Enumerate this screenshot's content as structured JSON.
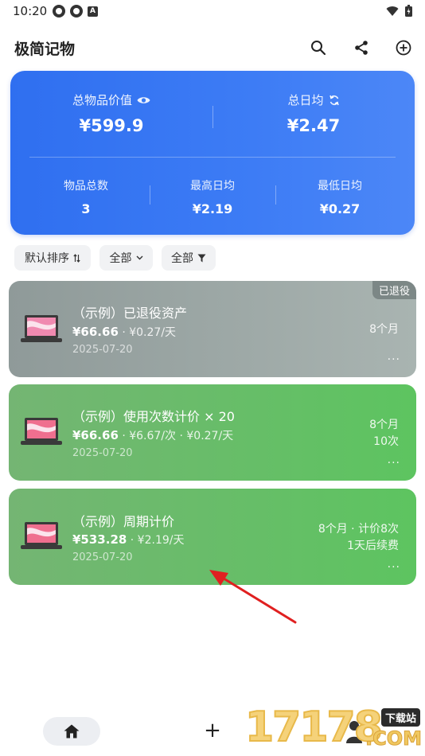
{
  "status_bar": {
    "time": "10:20"
  },
  "header": {
    "title": "极简记物"
  },
  "summary": {
    "total_value_label": "总物品价值",
    "total_value": "¥599.9",
    "daily_avg_label": "总日均",
    "daily_avg": "¥2.47",
    "item_count_label": "物品总数",
    "item_count": "3",
    "max_daily_label": "最高日均",
    "max_daily": "¥2.19",
    "min_daily_label": "最低日均",
    "min_daily": "¥0.27"
  },
  "filters": {
    "sort_label": "默认排序",
    "category_label": "全部",
    "status_label": "全部"
  },
  "items": [
    {
      "title": "（示例）已退役资产",
      "price": "¥66.66",
      "detail": " · ¥0.27/天",
      "date": "2025-07-20",
      "right_line1": "8个月",
      "badge": "已退役",
      "more": "···"
    },
    {
      "title": "（示例）使用次数计价 × 20",
      "price": "¥66.66",
      "detail": " · ¥6.67/次 · ¥0.27/天",
      "date": "2025-07-20",
      "right_line1": "8个月",
      "right_line2": "10次",
      "more": "···"
    },
    {
      "title": "（示例）周期计价",
      "price": "¥533.28",
      "detail": " · ¥2.19/天",
      "date": "2025-07-20",
      "right_line1": "8个月 · 计价8次",
      "right_line2": "1天后续费",
      "more": "···"
    }
  ],
  "bottom_nav": {
    "add_symbol": "+"
  },
  "watermark": {
    "number": "17178",
    "tag": "下载站",
    "suffix": ".COM"
  },
  "colors": {
    "summary_blue": "#3478f3",
    "card_green": "#5dc460",
    "card_gray": "#9aa5a3",
    "arrow_red": "#e02020"
  }
}
